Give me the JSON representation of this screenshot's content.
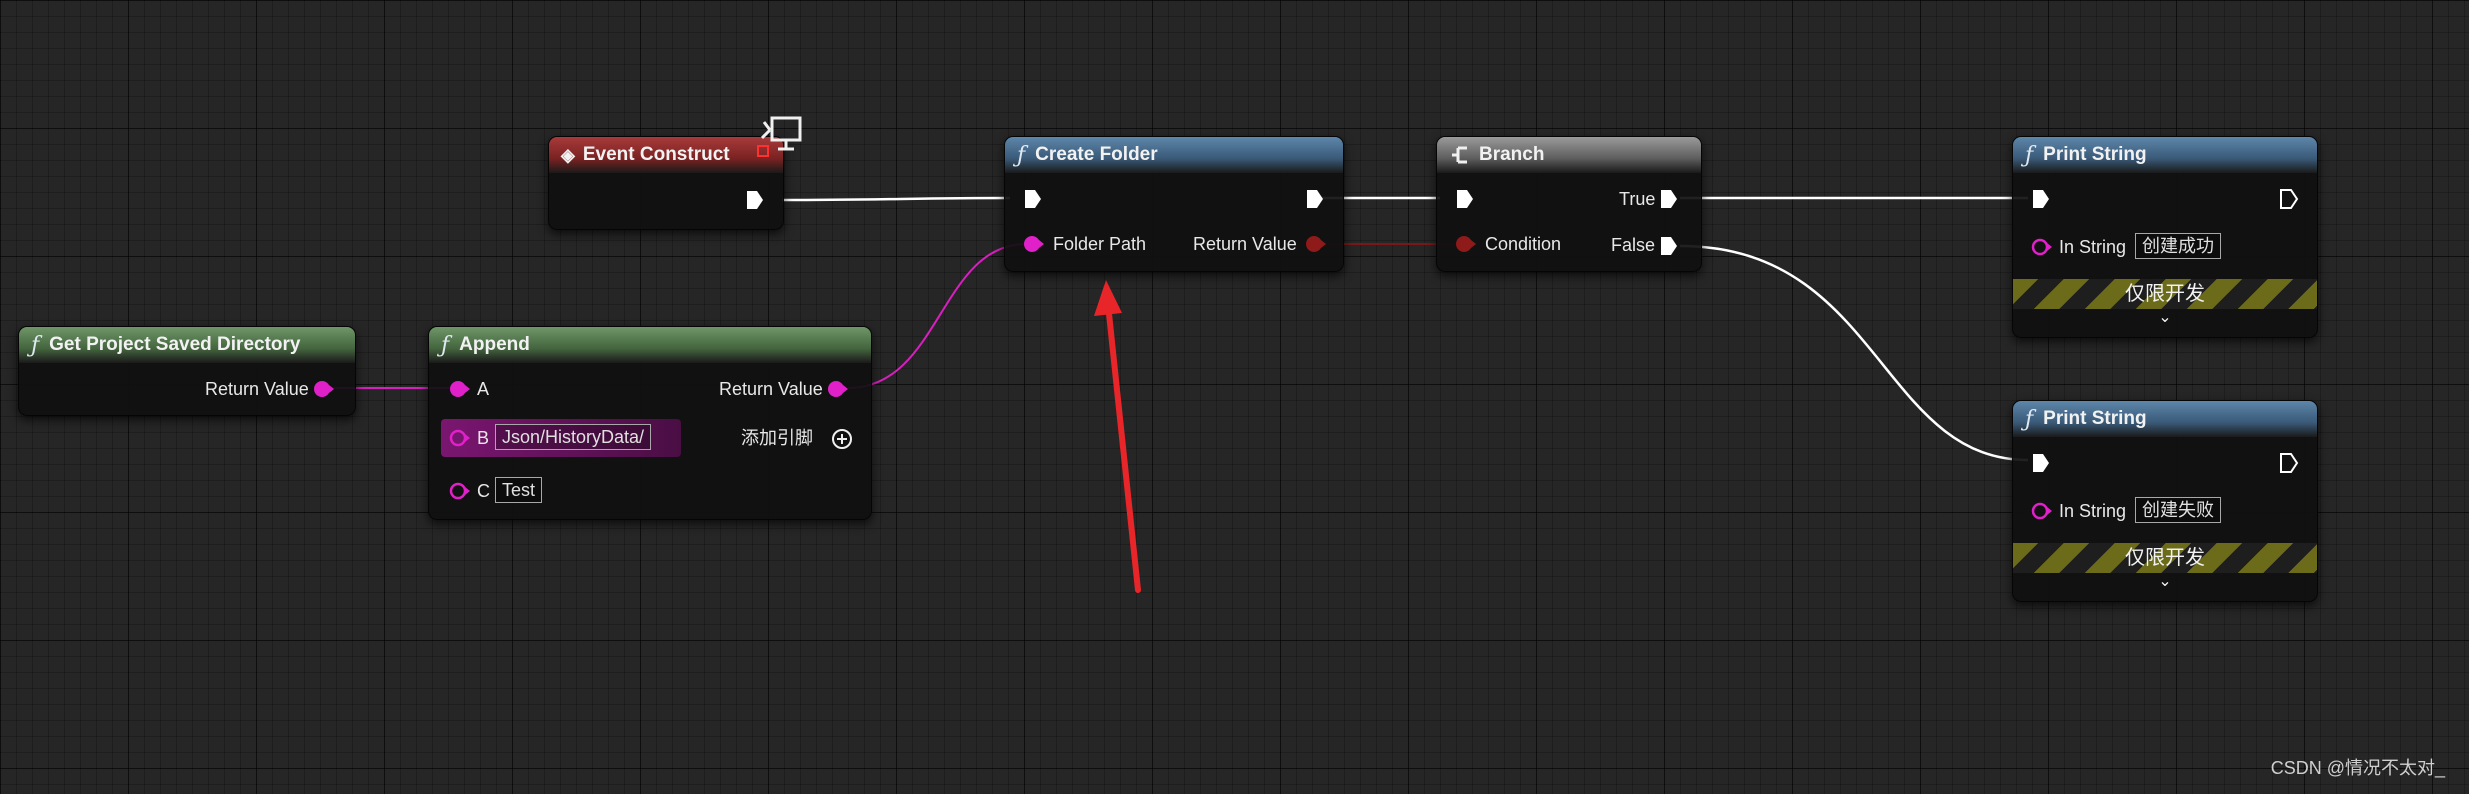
{
  "graph": {
    "event_construct": {
      "title": "Event Construct"
    },
    "create_folder": {
      "title": "Create Folder",
      "input_label": "Folder Path",
      "output_label": "Return Value"
    },
    "branch": {
      "title": "Branch",
      "condition_label": "Condition",
      "true_label": "True",
      "false_label": "False"
    },
    "get_dir": {
      "title": "Get Project Saved Directory",
      "output_label": "Return Value"
    },
    "append": {
      "title": "Append",
      "pin_a": "A",
      "pin_b": "B",
      "pin_c": "C",
      "b_value": "Json/HistoryData/",
      "c_value": "Test",
      "output_label": "Return Value",
      "add_pin_label": "添加引脚"
    },
    "print_success": {
      "title": "Print String",
      "in_label": "In String",
      "value": "创建成功",
      "dev_only": "仅限开发"
    },
    "print_fail": {
      "title": "Print String",
      "in_label": "In String",
      "value": "创建失败",
      "dev_only": "仅限开发"
    }
  },
  "colors": {
    "exec_wire": "#ffffff",
    "string_wire": "#e020c8",
    "bool_wire": "#8a1c1c",
    "annotation_arrow": "#e8262a"
  },
  "watermark": "CSDN @情况不太对_"
}
